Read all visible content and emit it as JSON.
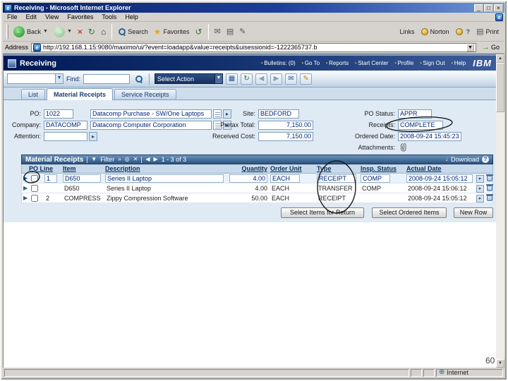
{
  "page": {
    "number": "60"
  },
  "browser": {
    "title": "Receiving - Microsoft Internet Explorer",
    "menu": [
      "File",
      "Edit",
      "View",
      "Favorites",
      "Tools",
      "Help"
    ],
    "toolbar": {
      "back_label": "Back",
      "search_label": "Search",
      "favorites_label": "Favorites",
      "links_label": "Links",
      "norton_label": "Norton",
      "help_label": "?",
      "print_label": "Print"
    },
    "address": {
      "label": "Address",
      "url": "http://192.168.1.15:9080/maximo/ui/?event=loadapp&value=receipts&uisessionid=-1222365737.b",
      "go_label": "Go"
    },
    "statusbar": {
      "zone": "Internet"
    }
  },
  "app": {
    "title": "Receiving",
    "header_links": [
      "Bulletins: (0)",
      "Go To",
      "Reports",
      "Start Center",
      "Profile",
      "Sign Out",
      "Help"
    ],
    "logo": "IBM",
    "toolbar": {
      "find_label": "Find:",
      "select_action_label": "Select Action"
    },
    "tabs": [
      "List",
      "Material Receipts",
      "Service Receipts"
    ]
  },
  "form": {
    "po": {
      "label": "PO:",
      "value": "1022",
      "description": "Datacomp Purchase - SW/One Laptops"
    },
    "company": {
      "label": "Company:",
      "value": "DATACOMP",
      "description": "Datacomp Computer Corporation"
    },
    "attention": {
      "label": "Attention:",
      "value": ""
    },
    "site": {
      "label": "Site:",
      "value": "BEDFORD"
    },
    "pretax_total": {
      "label": "Pretax Total:",
      "value": "7,150.00"
    },
    "received_cost": {
      "label": "Received Cost:",
      "value": "7,150.00"
    },
    "po_status": {
      "label": "PO Status:",
      "value": "APPR"
    },
    "receipts": {
      "label": "Receipts:",
      "value": "COMPLETE"
    },
    "ordered_date": {
      "label": "Ordered Date:",
      "value": "2008-09-24 15:45:23"
    },
    "attachments": {
      "label": "Attachments:"
    }
  },
  "grid": {
    "section_title": "Material Receipts",
    "filter_label": "Filter",
    "record_range": "1 - 3 of 3",
    "download_label": "Download",
    "headers": [
      "PO Line",
      "Item",
      "Description",
      "Quantity",
      "Order Unit",
      "Type",
      "Insp. Status",
      "Actual Date"
    ],
    "rows": [
      {
        "po_line": "1",
        "item": "D650",
        "description": "Series II Laptop",
        "quantity": "4.00",
        "order_unit": "EACH",
        "type": "RECEIPT",
        "insp_status": "COMP",
        "actual_date": "2008-09-24 15:05:12"
      },
      {
        "po_line": "",
        "item": "D650",
        "description": "Series II Laptop",
        "quantity": "4.00",
        "order_unit": "EACH",
        "type": "TRANSFER",
        "insp_status": "COMP",
        "actual_date": "2008-09-24 15:06:12"
      },
      {
        "po_line": "2",
        "item": "COMPRESS",
        "description": "Zippy Compression Software",
        "quantity": "50.00",
        "order_unit": "EACH",
        "type": "RECEIPT",
        "insp_status": "",
        "actual_date": "2008-09-24 15:05:12"
      }
    ],
    "buttons": [
      "Select Items for Return",
      "Select Ordered Items",
      "New Row"
    ]
  }
}
